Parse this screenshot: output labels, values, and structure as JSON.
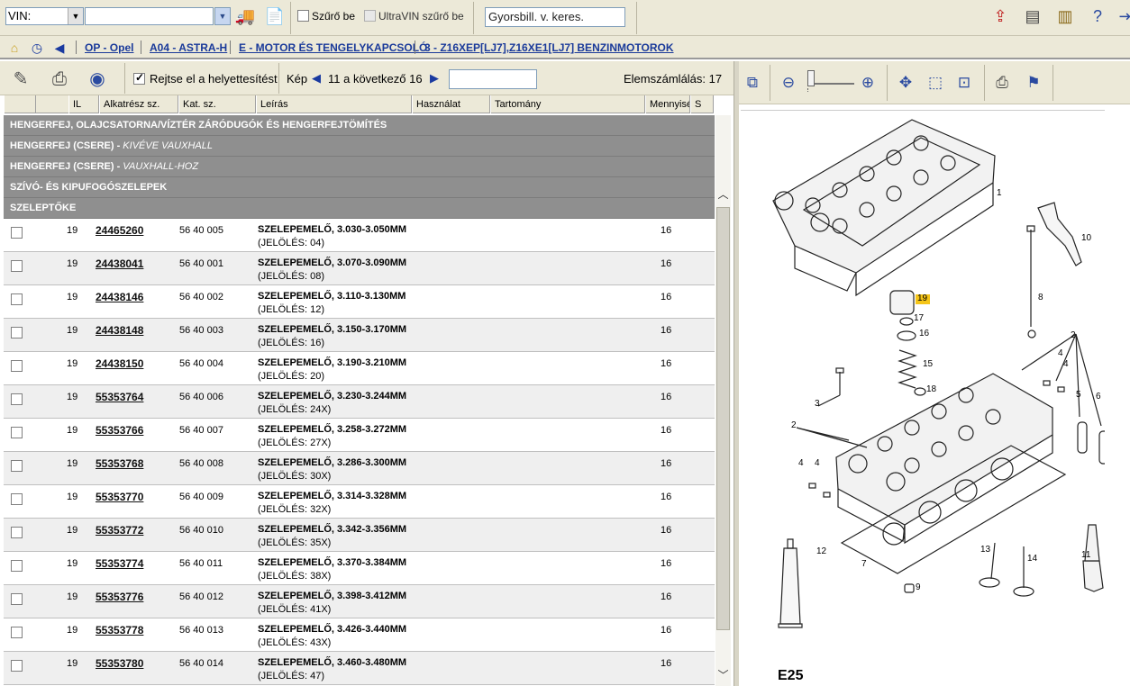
{
  "topbar": {
    "vin_select": "VIN:",
    "vin_value": "",
    "filter_checkbox": {
      "label": "Szűrő be",
      "checked": false
    },
    "ultravin_checkbox": {
      "label": "UltraVIN szűrő be",
      "checked": false,
      "disabled": true
    },
    "quick_search_placeholder": "Gyorsbill. v. keres."
  },
  "breadcrumb": {
    "items": [
      "OP - Opel",
      "A04 - ASTRA-H",
      "E - MOTOR ÉS TENGELYKAPCSOLÓ",
      "3 - Z16XEP[LJ7],Z16XE1[LJ7] BENZINMOTOROK"
    ]
  },
  "listbar": {
    "hide_replacement": {
      "label": "Rejtse el a helyettesítést",
      "checked": true
    },
    "image_label": "Kép",
    "page_info": "11 a következő 16",
    "count_label": "Elemszámlálás: 17"
  },
  "columns": [
    "",
    "IL",
    "Alkatrész sz.",
    "Kat. sz.",
    "Leírás",
    "Használat",
    "Tartomány",
    "Mennyisé",
    "S"
  ],
  "groups": [
    {
      "title": "HENGERFEJ, OLAJCSATORNA/VÍZTÉR ZÁRÓDUGÓK ÉS HENGERFEJTÖMÍTÉS",
      "note": ""
    },
    {
      "title": "HENGERFEJ (CSERE) - ",
      "note": "KIVÉVE VAUXHALL"
    },
    {
      "title": "HENGERFEJ (CSERE) - ",
      "note": "VAUXHALL-HOZ"
    },
    {
      "title": "SZÍVÓ- ÉS KIPUFOGÓSZELEPEK",
      "note": ""
    },
    {
      "title": "SZELEPTŐKE",
      "note": ""
    }
  ],
  "parts": [
    {
      "il": "19",
      "pn": "24465260",
      "kat": "56 40 005",
      "desc": "SZELEPEMELŐ, 3.030-3.050MM",
      "mark": "(JELÖLÉS: 04)",
      "qty": "16"
    },
    {
      "il": "19",
      "pn": "24438041",
      "kat": "56 40 001",
      "desc": "SZELEPEMELŐ, 3.070-3.090MM",
      "mark": "(JELÖLÉS: 08)",
      "qty": "16"
    },
    {
      "il": "19",
      "pn": "24438146",
      "kat": "56 40 002",
      "desc": "SZELEPEMELŐ, 3.110-3.130MM",
      "mark": "(JELÖLÉS: 12)",
      "qty": "16"
    },
    {
      "il": "19",
      "pn": "24438148",
      "kat": "56 40 003",
      "desc": "SZELEPEMELŐ, 3.150-3.170MM",
      "mark": "(JELÖLÉS: 16)",
      "qty": "16"
    },
    {
      "il": "19",
      "pn": "24438150",
      "kat": "56 40 004",
      "desc": "SZELEPEMELŐ, 3.190-3.210MM",
      "mark": "(JELÖLÉS: 20)",
      "qty": "16"
    },
    {
      "il": "19",
      "pn": "55353764",
      "kat": "56 40 006",
      "desc": "SZELEPEMELŐ, 3.230-3.244MM",
      "mark": "(JELÖLÉS: 24X)",
      "qty": "16"
    },
    {
      "il": "19",
      "pn": "55353766",
      "kat": "56 40 007",
      "desc": "SZELEPEMELŐ, 3.258-3.272MM",
      "mark": "(JELÖLÉS: 27X)",
      "qty": "16"
    },
    {
      "il": "19",
      "pn": "55353768",
      "kat": "56 40 008",
      "desc": "SZELEPEMELŐ, 3.286-3.300MM",
      "mark": "(JELÖLÉS: 30X)",
      "qty": "16"
    },
    {
      "il": "19",
      "pn": "55353770",
      "kat": "56 40 009",
      "desc": "SZELEPEMELŐ, 3.314-3.328MM",
      "mark": "(JELÖLÉS: 32X)",
      "qty": "16"
    },
    {
      "il": "19",
      "pn": "55353772",
      "kat": "56 40 010",
      "desc": "SZELEPEMELŐ, 3.342-3.356MM",
      "mark": "(JELÖLÉS: 35X)",
      "qty": "16"
    },
    {
      "il": "19",
      "pn": "55353774",
      "kat": "56 40 011",
      "desc": "SZELEPEMELŐ, 3.370-3.384MM",
      "mark": "(JELÖLÉS: 38X)",
      "qty": "16"
    },
    {
      "il": "19",
      "pn": "55353776",
      "kat": "56 40 012",
      "desc": "SZELEPEMELŐ, 3.398-3.412MM",
      "mark": "(JELÖLÉS: 41X)",
      "qty": "16"
    },
    {
      "il": "19",
      "pn": "55353778",
      "kat": "56 40 013",
      "desc": "SZELEPEMELŐ, 3.426-3.440MM",
      "mark": "(JELÖLÉS: 43X)",
      "qty": "16"
    },
    {
      "il": "19",
      "pn": "55353780",
      "kat": "56 40 014",
      "desc": "SZELEPEMELŐ, 3.460-3.480MM",
      "mark": "(JELÖLÉS: 47)",
      "qty": "16"
    }
  ],
  "diagram": {
    "figure_label": "E25",
    "callouts": [
      "1",
      "10",
      "19",
      "17",
      "16",
      "15",
      "18",
      "8",
      "2",
      "4",
      "4",
      "5",
      "6",
      "3",
      "2",
      "4",
      "4",
      "12",
      "7",
      "9",
      "13",
      "14",
      "11"
    ],
    "highlight_callout": "19",
    "highlight_color": "#f5c518"
  },
  "colors": {
    "toolbar_bg": "#ece9d8",
    "group_bg": "#8f8f8f",
    "link": "#1a3a9a"
  }
}
